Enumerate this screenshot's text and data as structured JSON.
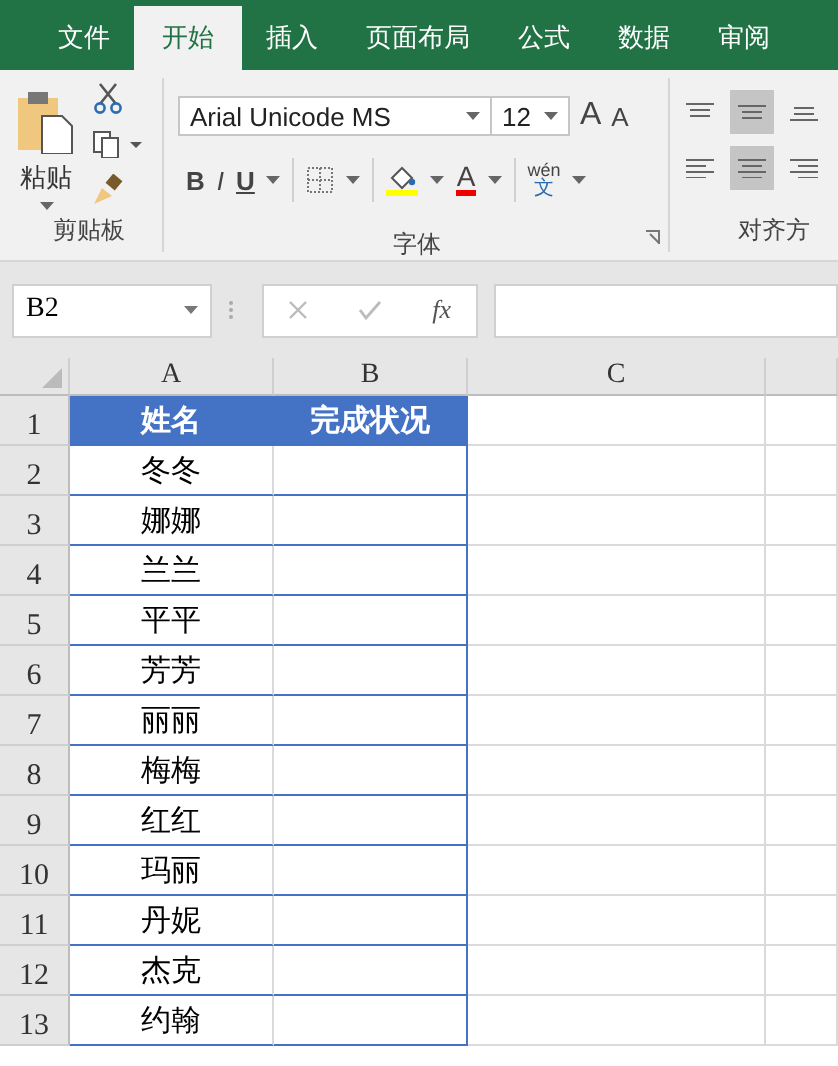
{
  "tabs": [
    {
      "label": "文件",
      "selected": false
    },
    {
      "label": "开始",
      "selected": true
    },
    {
      "label": "插入",
      "selected": false
    },
    {
      "label": "页面布局",
      "selected": false
    },
    {
      "label": "公式",
      "selected": false
    },
    {
      "label": "数据",
      "selected": false
    },
    {
      "label": "审阅",
      "selected": false
    }
  ],
  "ribbon": {
    "clipboard": {
      "paste_label": "粘贴",
      "group_label": "剪贴板"
    },
    "font": {
      "font_name": "Arial Unicode MS",
      "font_size": "12",
      "grow": "A",
      "shrink": "A",
      "bold": "B",
      "italic": "I",
      "underline": "U",
      "font_color": "A",
      "phonetic_top": "wén",
      "phonetic_bottom": "文",
      "group_label": "字体"
    },
    "alignment": {
      "group_label": "对齐方"
    }
  },
  "formula_bar": {
    "name_box": "B2",
    "function_label": "fx"
  },
  "sheet": {
    "columns": [
      "A",
      "B",
      "C"
    ],
    "header": {
      "number": "1",
      "cells": [
        "姓名",
        "完成状况"
      ]
    },
    "rows": [
      {
        "number": "2",
        "name": "冬冬"
      },
      {
        "number": "3",
        "name": "娜娜"
      },
      {
        "number": "4",
        "name": "兰兰"
      },
      {
        "number": "5",
        "name": "平平"
      },
      {
        "number": "6",
        "name": "芳芳"
      },
      {
        "number": "7",
        "name": "丽丽"
      },
      {
        "number": "8",
        "name": "梅梅"
      },
      {
        "number": "9",
        "name": "红红"
      },
      {
        "number": "10",
        "name": "玛丽"
      },
      {
        "number": "11",
        "name": "丹妮"
      },
      {
        "number": "12",
        "name": "杰克"
      },
      {
        "number": "13",
        "name": "约翰"
      }
    ]
  }
}
